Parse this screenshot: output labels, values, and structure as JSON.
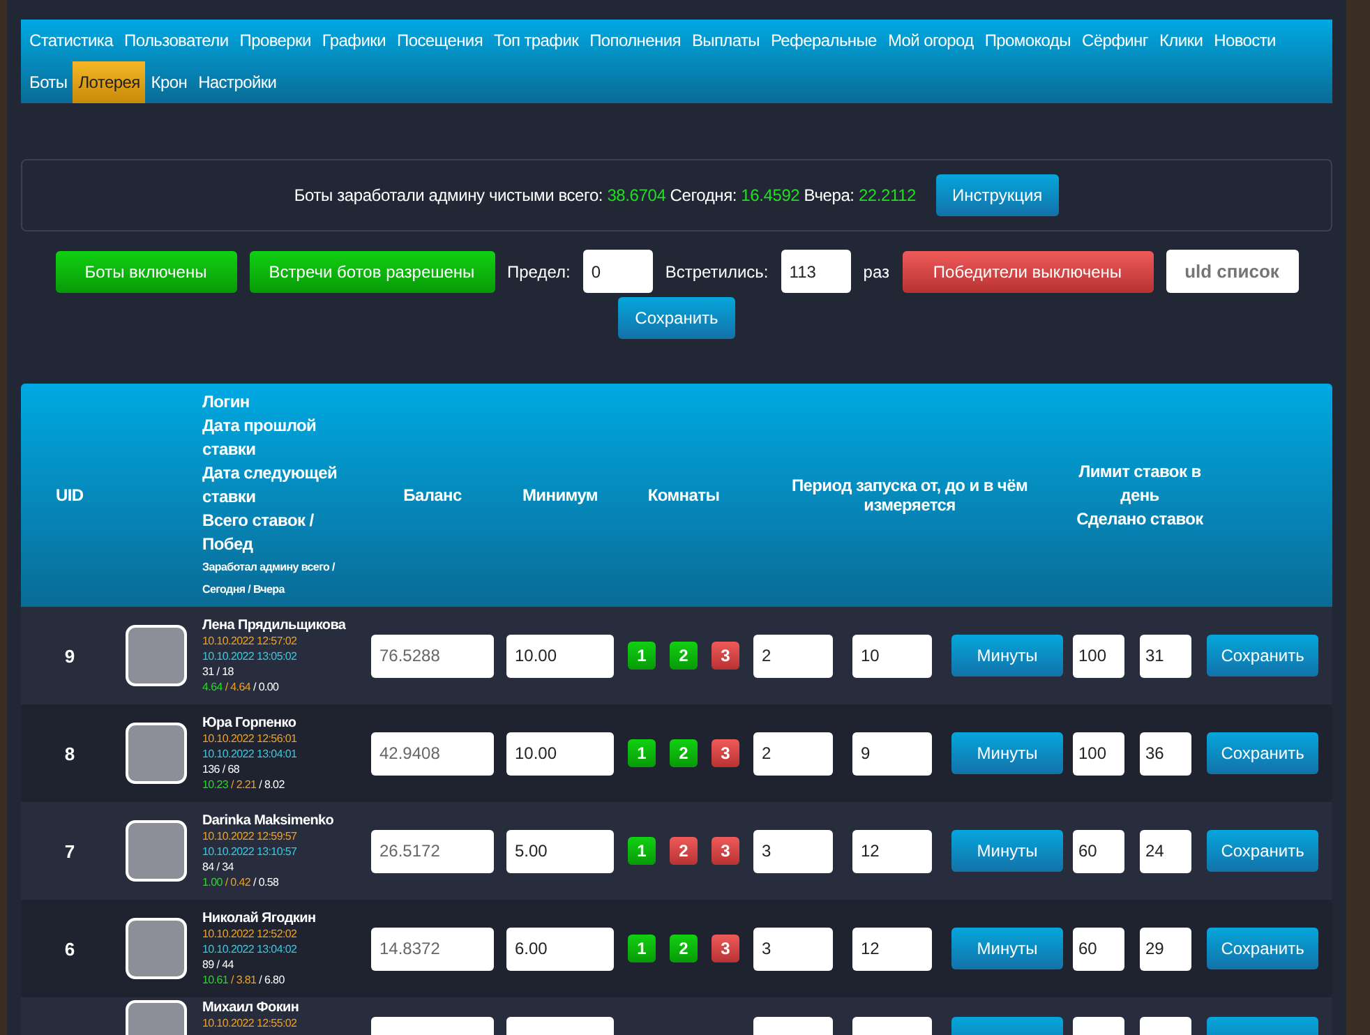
{
  "nav": [
    {
      "label": "Статистика",
      "selected": false
    },
    {
      "label": "Пользователи",
      "selected": false
    },
    {
      "label": "Проверки",
      "selected": false
    },
    {
      "label": "Графики",
      "selected": false
    },
    {
      "label": "Посещения",
      "selected": false
    },
    {
      "label": "Топ трафик",
      "selected": false
    },
    {
      "label": "Пополнения",
      "selected": false
    },
    {
      "label": "Выплаты",
      "selected": false
    },
    {
      "label": "Реферальные",
      "selected": false
    },
    {
      "label": "Мой огород",
      "selected": false
    },
    {
      "label": "Промокоды",
      "selected": false
    },
    {
      "label": "Сёрфинг",
      "selected": false
    },
    {
      "label": "Клики",
      "selected": false
    },
    {
      "label": "Новости",
      "selected": false
    },
    {
      "label": "Боты",
      "selected": false
    },
    {
      "label": "Лотерея",
      "selected": true
    },
    {
      "label": "Крон",
      "selected": false
    },
    {
      "label": "Настройки",
      "selected": false
    }
  ],
  "earnings": {
    "label_total": "Боты заработали админу чистыми всего:",
    "total": "38.6704",
    "label_today": "Сегодня:",
    "today": "16.4592",
    "label_yesterday": "Вчера:",
    "yesterday": "22.2112",
    "button": "Инструкция"
  },
  "controls": {
    "bots_toggle": {
      "label": "Боты включены",
      "on": true
    },
    "meetings_toggle": {
      "label": "Встречи ботов разрешены",
      "on": true
    },
    "limit_label": "Предел:",
    "limit_value": "0",
    "met_label": "Встретились:",
    "met_value": "113",
    "times_label": "раз",
    "winners_toggle": {
      "label": "Победители выключены",
      "on": false
    },
    "uid_list": {
      "placeholder": "uld список"
    },
    "save": "Сохранить"
  },
  "table": {
    "columns": {
      "uid": "UID",
      "login": [
        "Логин",
        "Дата прошлой ставки",
        "Дата следующей ставки",
        "Всего ставок / Побед"
      ],
      "login_note": "Заработал админу всего / Сегодня / Вчера",
      "balance": "Баланс",
      "minimum": "Минимум",
      "rooms": "Комнаты",
      "period": "Период запуска от, до и в чём измеряется",
      "limit": [
        "Лимит ставок в день",
        "Сделано ставок"
      ]
    },
    "rows": [
      {
        "uid": "9",
        "name": "Лена Прядильщикова",
        "last_bet": "10.10.2022 12:57:02",
        "next_bet": "10.10.2022 13:05:02",
        "bets": "31 / 18",
        "earn_total": "4.64",
        "earn_today": "/ 4.64",
        "earn_yesterday": "/ 0.00",
        "balance": "76.5288",
        "minimum": "10.00",
        "rooms": [
          {
            "label": "1",
            "on": true
          },
          {
            "label": "2",
            "on": true
          },
          {
            "label": "3",
            "on": false
          }
        ],
        "from": "2",
        "to": "10",
        "unit": "Минуты",
        "limit": "100",
        "done": "31",
        "save": "Сохранить"
      },
      {
        "uid": "8",
        "name": "Юра Горпенко",
        "last_bet": "10.10.2022 12:56:01",
        "next_bet": "10.10.2022 13:04:01",
        "bets": "136 / 68",
        "earn_total": "10.23",
        "earn_today": "/ 2.21",
        "earn_yesterday": "/ 8.02",
        "balance": "42.9408",
        "minimum": "10.00",
        "rooms": [
          {
            "label": "1",
            "on": true
          },
          {
            "label": "2",
            "on": true
          },
          {
            "label": "3",
            "on": false
          }
        ],
        "from": "2",
        "to": "9",
        "unit": "Минуты",
        "limit": "100",
        "done": "36",
        "save": "Сохранить"
      },
      {
        "uid": "7",
        "name": "Darinka Maksimenko",
        "last_bet": "10.10.2022 12:59:57",
        "next_bet": "10.10.2022 13:10:57",
        "bets": "84 / 34",
        "earn_total": "1.00",
        "earn_today": "/ 0.42",
        "earn_yesterday": "/ 0.58",
        "balance": "26.5172",
        "minimum": "5.00",
        "rooms": [
          {
            "label": "1",
            "on": true
          },
          {
            "label": "2",
            "on": false
          },
          {
            "label": "3",
            "on": false
          }
        ],
        "from": "3",
        "to": "12",
        "unit": "Минуты",
        "limit": "60",
        "done": "24",
        "save": "Сохранить"
      },
      {
        "uid": "6",
        "name": "Николай Ягодкин",
        "last_bet": "10.10.2022 12:52:02",
        "next_bet": "10.10.2022 13:04:02",
        "bets": "89 / 44",
        "earn_total": "10.61",
        "earn_today": "/ 3.81",
        "earn_yesterday": "/ 6.80",
        "balance": "14.8372",
        "minimum": "6.00",
        "rooms": [
          {
            "label": "1",
            "on": true
          },
          {
            "label": "2",
            "on": true
          },
          {
            "label": "3",
            "on": false
          }
        ],
        "from": "3",
        "to": "12",
        "unit": "Минуты",
        "limit": "60",
        "done": "29",
        "save": "Сохранить"
      }
    ],
    "partial_row": {
      "name": "Михаил Фокин",
      "last_bet": "10.10.2022 12:55:02"
    }
  }
}
